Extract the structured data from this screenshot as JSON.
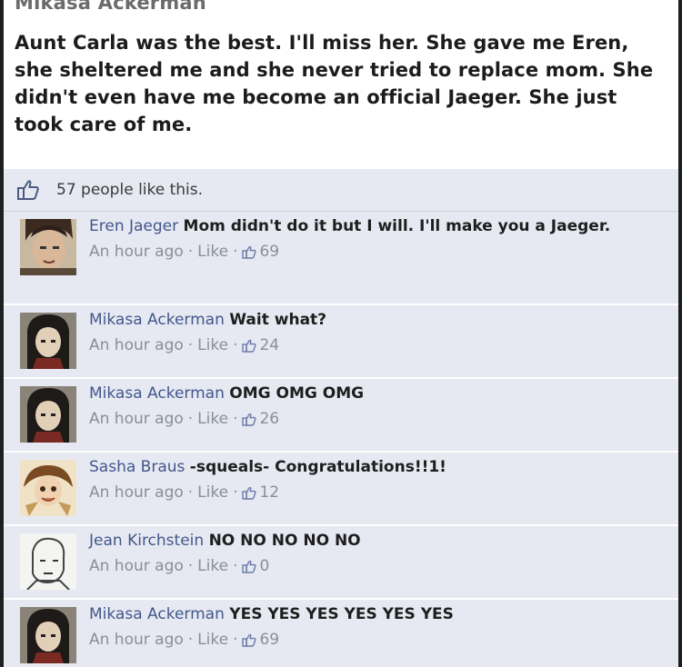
{
  "post": {
    "author": "Mikasa Ackerman",
    "text": "Aunt Carla was the best. I'll miss her. She gave me Eren, she sheltered me and she never tried to replace mom. She didn't even have me become an official Jaeger. She just took care of me."
  },
  "likes": {
    "text": "57 people like this."
  },
  "comments": [
    {
      "name": "Eren Jaeger",
      "text": "Mom didn't do it but I will.  I'll make you a Jaeger.",
      "time": "An hour ago",
      "like_label": "Like",
      "likes": "69",
      "avatar": "eren"
    },
    {
      "name": "Mikasa Ackerman",
      "text": "Wait what?",
      "time": "An hour ago",
      "like_label": "Like",
      "likes": "24",
      "avatar": "mikasa"
    },
    {
      "name": "Mikasa Ackerman",
      "text": "OMG OMG OMG",
      "time": "An hour ago",
      "like_label": "Like",
      "likes": "26",
      "avatar": "mikasa"
    },
    {
      "name": "Sasha Braus",
      "text": "-squeals- Congratulations!!1!",
      "time": "An hour ago",
      "like_label": "Like",
      "likes": "12",
      "avatar": "sasha"
    },
    {
      "name": "Jean Kirchstein",
      "text": "NO NO NO NO NO",
      "time": "An hour ago",
      "like_label": "Like",
      "likes": "0",
      "avatar": "jean"
    },
    {
      "name": "Mikasa Ackerman",
      "text": "YES YES YES YES YES YES",
      "time": "An hour ago",
      "like_label": "Like",
      "likes": "69",
      "avatar": "mikasa"
    }
  ],
  "colors": {
    "feedback_bg": "#e6e9f1",
    "name_link": "#42578c",
    "meta_text": "#8a8e98"
  }
}
